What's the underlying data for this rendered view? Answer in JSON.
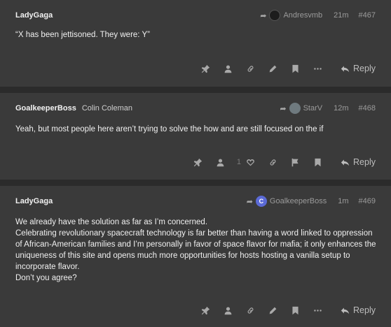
{
  "posts": [
    {
      "username": "LadyGaga",
      "fullname": "",
      "reply_to": "Andresvmb",
      "time": "21m",
      "number": "#467",
      "body": [
        "“X has been jettisoned. They were: Y”"
      ],
      "likes": "",
      "reply_label": "Reply"
    },
    {
      "username": "GoalkeeperBoss",
      "fullname": "Colin Coleman",
      "reply_to": "StarV",
      "time": "12m",
      "number": "#468",
      "body": [
        "Yeah, but most people here aren’t trying to solve the how and are still focused on the if"
      ],
      "likes": "1",
      "reply_label": "Reply"
    },
    {
      "username": "LadyGaga",
      "fullname": "",
      "reply_to": "GoalkeeperBoss",
      "reply_to_avatar_letter": "C",
      "time": "1m",
      "number": "#469",
      "body": [
        "We already have the solution as far as I’m concerned.",
        "Celebrating revolutionary spacecraft technology is far better than having a word linked to oppression of African-American families and I’m personally in favor of space flavor for mafia; it only enhances the uniqueness of this site and opens much more opportunities for hosts hosting a vanilla setup to incorporate flavor.",
        "Don’t you agree?"
      ],
      "likes": "",
      "reply_label": "Reply"
    }
  ],
  "colors": {
    "background": "#2b2b2b",
    "post_background": "#3a3a3a",
    "avatar_blue": "#5b6ad6"
  }
}
